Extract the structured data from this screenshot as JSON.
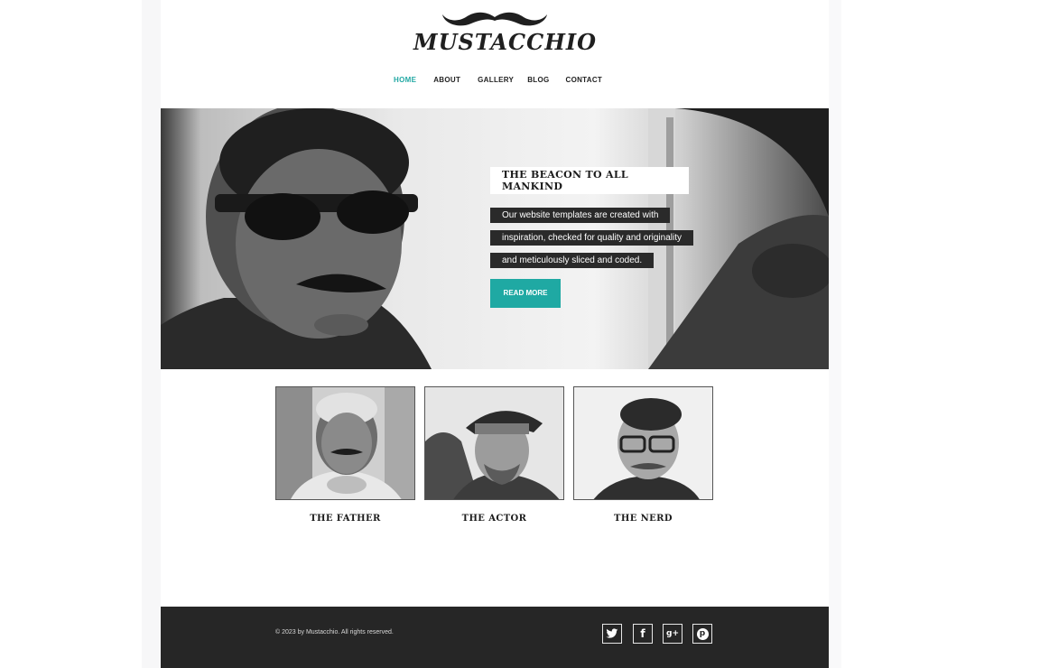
{
  "brand": {
    "logo_text": "MUSTACCHIO"
  },
  "nav": {
    "items": [
      {
        "label": "HOME",
        "active": true
      },
      {
        "label": "ABOUT",
        "active": false
      },
      {
        "label": "GALLERY",
        "active": false
      },
      {
        "label": "BLOG",
        "active": false
      },
      {
        "label": "CONTACT",
        "active": false
      }
    ]
  },
  "hero": {
    "title": "THE BEACON TO ALL MANKIND",
    "lines": [
      "Our website templates are created with",
      "inspiration, checked for quality and originality",
      "and meticulously sliced and coded."
    ],
    "button_label": "READ MORE"
  },
  "cards": [
    {
      "name": "THE FATHER"
    },
    {
      "name": "THE ACTOR"
    },
    {
      "name": "THE NERD"
    }
  ],
  "footer": {
    "copyright": "© 2023 by Mustacchio. All rights reserved.",
    "social": [
      {
        "icon": "twitter-icon",
        "glyph": "🐦"
      },
      {
        "icon": "facebook-icon",
        "glyph": "f"
      },
      {
        "icon": "google-plus-icon",
        "glyph": "g+"
      },
      {
        "icon": "pinterest-icon",
        "glyph": "p"
      }
    ]
  },
  "colors": {
    "accent": "#23a9a4",
    "footer_bg": "#262626",
    "text_dark": "#1d1d1d"
  }
}
